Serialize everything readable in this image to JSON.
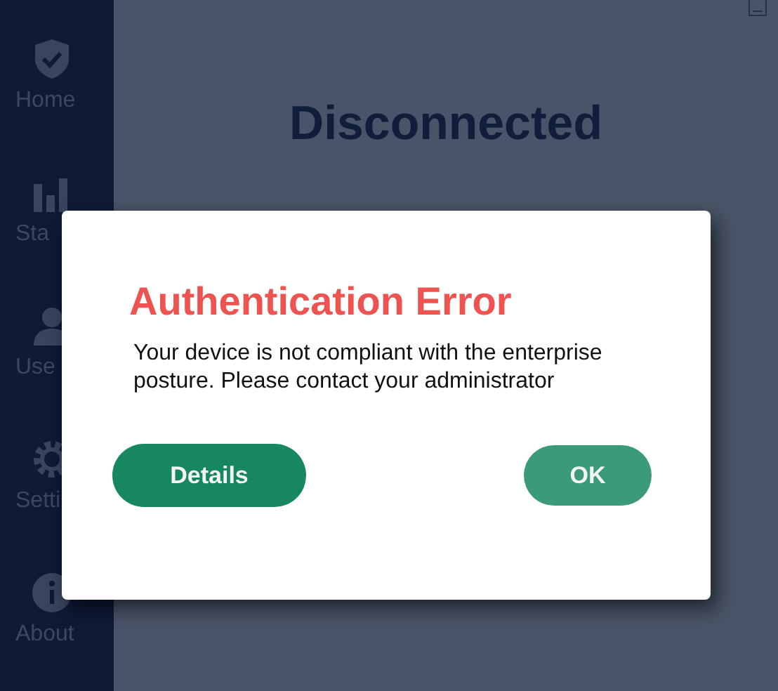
{
  "sidebar": {
    "items": [
      {
        "kind": "shield",
        "label": "Home"
      },
      {
        "kind": "chart",
        "label": "Sta"
      },
      {
        "kind": "user",
        "label": "Use"
      },
      {
        "kind": "gear",
        "label": "Setti"
      },
      {
        "kind": "info",
        "label": "About"
      }
    ]
  },
  "main": {
    "status": "Disconnected"
  },
  "dialog": {
    "title": "Authentication Error",
    "message": "Your device is not compliant with the enterprise posture. Please contact your administrator",
    "buttons": [
      {
        "label": "Details",
        "kind": "primary"
      },
      {
        "label": "OK",
        "kind": "secondary"
      }
    ]
  }
}
